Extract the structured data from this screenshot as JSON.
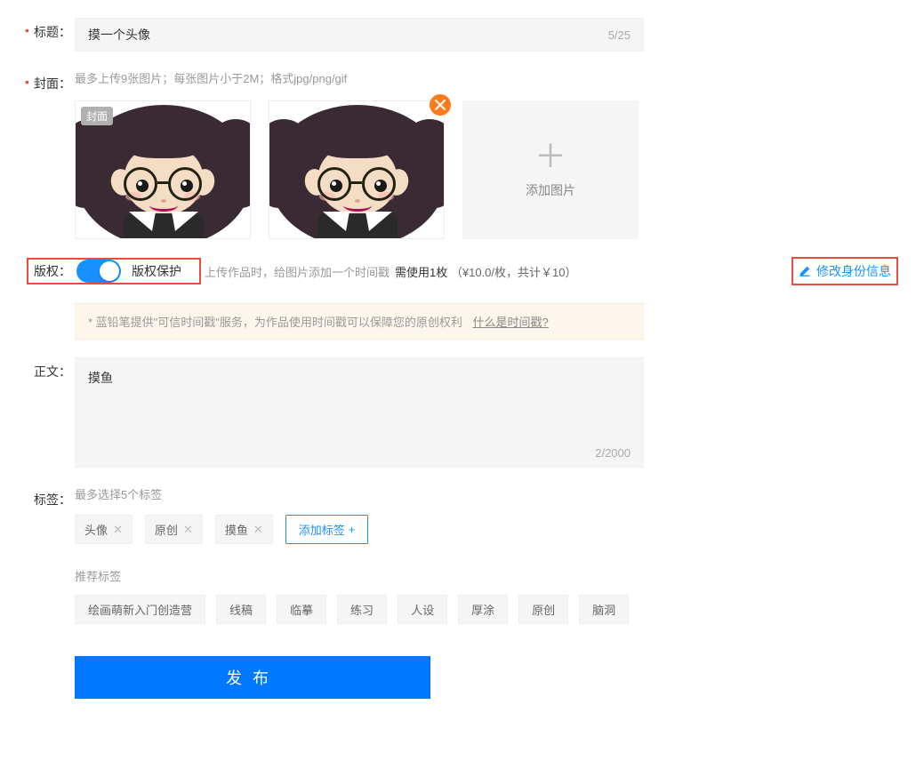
{
  "title": {
    "label": "标题：",
    "value": "摸一个头像",
    "counter": "5/25"
  },
  "cover": {
    "label": "封面：",
    "help": "最多上传9张图片；每张图片小于2M；格式jpg/png/gif",
    "badge": "封面",
    "add_label": "添加图片"
  },
  "copyright": {
    "label": "版权：",
    "switch_label": "版权保护",
    "hint": "上传作品时，给图片添加一个时间戳",
    "cost_prefix": "需使用1枚",
    "cost_detail": "（¥10.0/枚，共计￥10）",
    "edit_identity": "修改身份信息",
    "tip_text": "* 蓝铅笔提供\"可信时间戳\"服务，为作品使用时间戳可以保障您的原创权利",
    "tip_link": "什么是时间戳?"
  },
  "content": {
    "label": "正文：",
    "value": "摸鱼",
    "counter": "2/2000"
  },
  "tags": {
    "label": "标签：",
    "help": "最多选择5个标签",
    "selected": [
      "头像",
      "原创",
      "摸鱼"
    ],
    "add_label": "添加标签",
    "rec_label": "推荐标签",
    "recommended": [
      "绘画萌新入门创造营",
      "线稿",
      "临摹",
      "练习",
      "人设",
      "厚涂",
      "原创",
      "脑洞"
    ]
  },
  "publish": "发布"
}
